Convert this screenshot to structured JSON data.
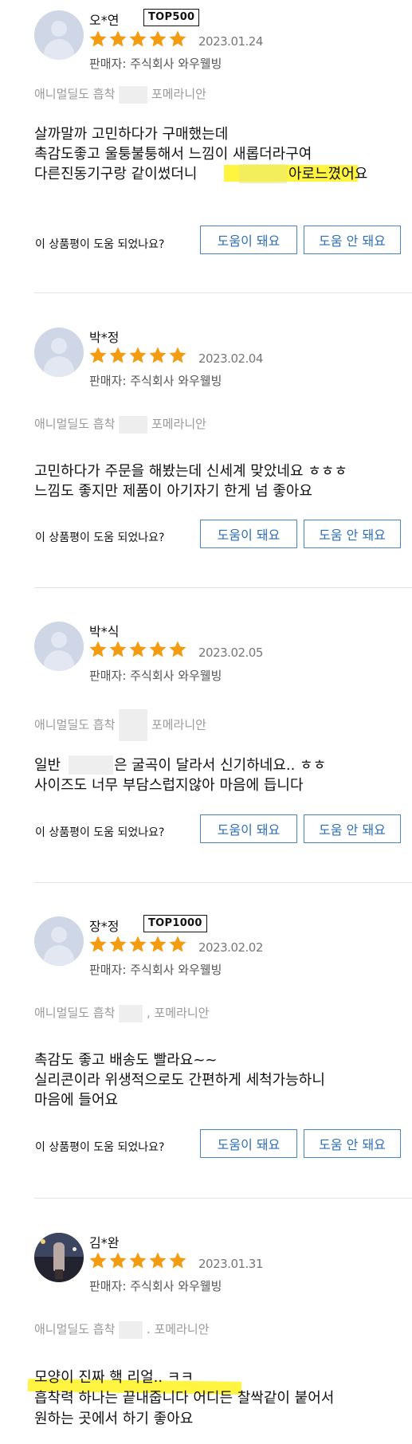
{
  "reviews": [
    {
      "nickname": "오*연",
      "badge": "TOP500",
      "rating": 5,
      "date": "2023.01.24",
      "seller": "판매자: 주식회사 와우웰빙",
      "option_prefix": "애니멀딜도 흡착",
      "option_suffix": "포메라니안",
      "lines": [
        "살까말까 고민하다가 구매했는데",
        "촉감도좋고 울퉁불퉁해서 느낌이 새롭더라구여",
        "다른진동기구랑 같이썼더니",
        "아로느꼈어요"
      ],
      "helpful_question": "이 상품평이 도움 되었나요?",
      "yes_label": "도움이 돼요",
      "no_label": "도움 안 돼요"
    },
    {
      "nickname": "박*정",
      "badge": "",
      "rating": 5,
      "date": "2023.02.04",
      "seller": "판매자: 주식회사 와우웰빙",
      "option_prefix": "애니멀딜도 흡착",
      "option_suffix": "포메라니안",
      "lines": [
        "고민하다가 주문을 해봤는데 신세계 맞았네요 ㅎㅎㅎ",
        "느낌도 좋지만 제품이 아기자기 한게 넘 좋아요"
      ],
      "helpful_question": "이 상품평이 도움 되었나요?",
      "yes_label": "도움이 돼요",
      "no_label": "도움 안 돼요"
    },
    {
      "nickname": "박*식",
      "badge": "",
      "rating": 5,
      "date": "2023.02.05",
      "seller": "판매자: 주식회사 와우웰빙",
      "option_prefix": "애니멀딜도 흡착",
      "option_suffix": "포메라니안",
      "lines": [
        "일반",
        "은 굴곡이 달라서 신기하네요.. ㅎㅎ",
        "사이즈도 너무 부담스럽지않아 마음에 듭니다"
      ],
      "helpful_question": "이 상품평이 도움 되었나요?",
      "yes_label": "도움이 돼요",
      "no_label": "도움 안 돼요"
    },
    {
      "nickname": "장*정",
      "badge": "TOP1000",
      "rating": 5,
      "date": "2023.02.02",
      "seller": "판매자: 주식회사 와우웰빙",
      "option_prefix": "애니멀딜도 흡착",
      "option_suffix": ", 포메라니안",
      "lines": [
        "촉감도 좋고 배송도 빨라요~~",
        "실리콘이라 위생적으로도 간편하게 세척가능하니",
        "마음에 들어요"
      ],
      "helpful_question": "이 상품평이 도움 되었나요?",
      "yes_label": "도움이 돼요",
      "no_label": "도움 안 돼요"
    },
    {
      "nickname": "김*완",
      "badge": "",
      "rating": 5,
      "date": "2023.01.31",
      "seller": "판매자: 주식회사 와우웰빙",
      "option_prefix": "애니멀딜도 흡착",
      "option_suffix": ". 포메라니안",
      "lines": [
        "모양이 진짜 핵 리얼.. ㅋㅋ",
        "흡착력 하나는 끝내줍니다 어디든 찰싹같이 붙어서",
        "원하는 곳에서 하기 좋아요"
      ]
    }
  ],
  "colors": {
    "star": "#f39c12",
    "button_border": "#4a86c5",
    "button_text": "#2d6fb7",
    "highlight": "#fff000"
  },
  "icons": [
    "user-avatar-icon",
    "star-icon"
  ]
}
